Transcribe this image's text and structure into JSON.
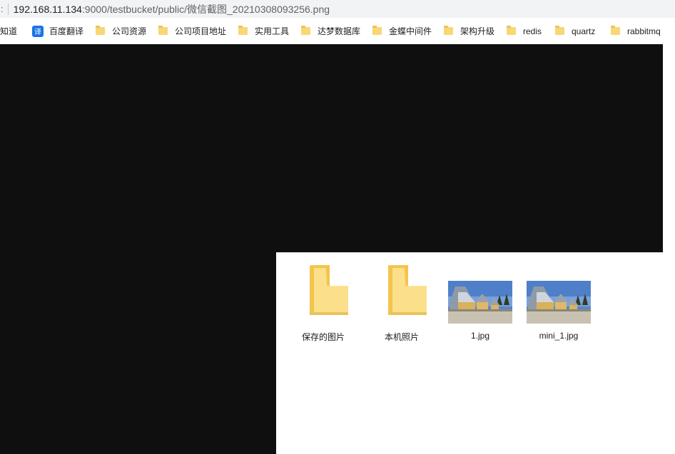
{
  "address_bar": {
    "prefix": ":",
    "url_host": "192.168.11.134",
    "url_rest": ":9000/testbucket/public/微信截图_20210308093256.png"
  },
  "bookmarks": [
    {
      "label": "我知道",
      "icon": "none"
    },
    {
      "label": "百度翻译",
      "icon": "translate-icon",
      "icon_text": "译"
    },
    {
      "label": "公司资源",
      "icon": "folder-icon"
    },
    {
      "label": "公司项目地址",
      "icon": "folder-icon"
    },
    {
      "label": "实用工具",
      "icon": "folder-icon"
    },
    {
      "label": "达梦数据库",
      "icon": "folder-icon"
    },
    {
      "label": "金蝶中间件",
      "icon": "folder-icon"
    },
    {
      "label": "架构升级",
      "icon": "folder-icon"
    },
    {
      "label": "redis",
      "icon": "folder-icon"
    },
    {
      "label": "quartz",
      "icon": "folder-icon"
    },
    {
      "label": "rabbitmq",
      "icon": "folder-icon"
    }
  ],
  "explorer": {
    "items": [
      {
        "name": "保存的图片",
        "type": "folder"
      },
      {
        "name": "本机照片",
        "type": "folder"
      },
      {
        "name": "1.jpg",
        "type": "image"
      },
      {
        "name": "mini_1.jpg",
        "type": "image"
      }
    ]
  },
  "colors": {
    "dark_background": "#0f0f0f",
    "address_bar_bg": "#f1f3f4",
    "folder_yellow": "#fbdf8a"
  }
}
